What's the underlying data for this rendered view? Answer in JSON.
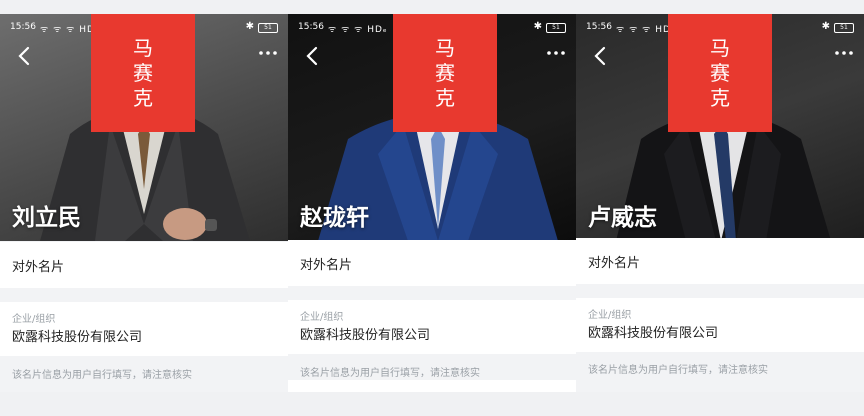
{
  "status": {
    "time": "15:56",
    "signal_left": "ᯤ ᯤ ᯤ HD",
    "signal_mid": "ᯤ ᯤ ᯤ HDₑ",
    "battery": "51"
  },
  "cards": [
    {
      "name": "刘立民",
      "redaction": [
        "马",
        "赛",
        "克"
      ],
      "external_card_label": "对外名片",
      "org_label": "企业/组织",
      "org_value": "欧露科技股份有限公司",
      "notice": "该名片信息为用户自行填写，请注意核实"
    },
    {
      "name": "赵珑轩",
      "redaction": [
        "马",
        "赛",
        "克"
      ],
      "external_card_label": "对外名片",
      "org_label": "企业/组织",
      "org_value": "欧露科技股份有限公司",
      "notice": "该名片信息为用户自行填写，请注意核实"
    },
    {
      "name": "卢威志",
      "redaction": [
        "马",
        "赛",
        "克"
      ],
      "external_card_label": "对外名片",
      "org_label": "企业/组织",
      "org_value": "欧露科技股份有限公司",
      "notice": "该名片信息为用户自行填写，请注意核实"
    }
  ],
  "icons": {
    "back": "chevron-left-icon",
    "more": "more-horizontal-icon",
    "bluetooth": "bluetooth-icon",
    "battery": "battery-icon"
  },
  "colors": {
    "redaction": "#e8392f",
    "background": "#f2f3f5",
    "secondary_text": "#9aa0a6"
  }
}
